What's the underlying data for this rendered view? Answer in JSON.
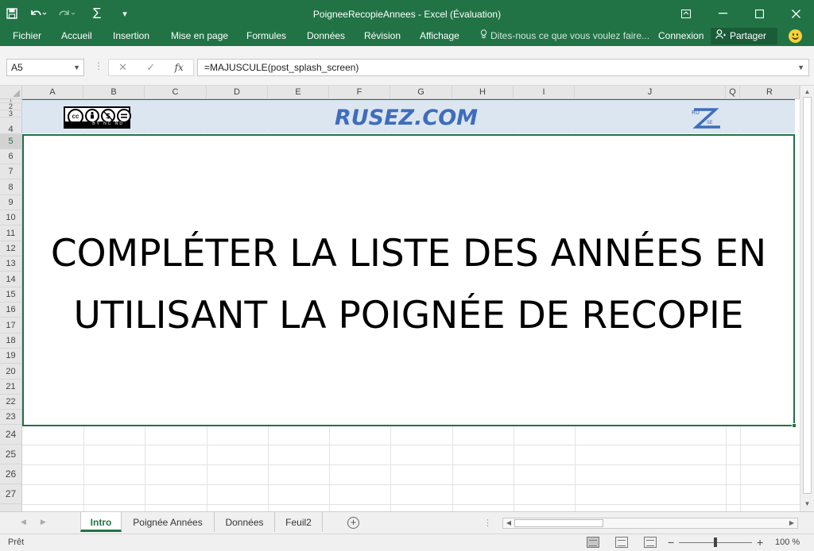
{
  "window": {
    "title": "PoigneeRecopieAnnees - Excel (Évaluation)"
  },
  "qat": {
    "save_icon": "save-icon",
    "undo_icon": "undo-icon",
    "redo_icon": "redo-icon",
    "autosum_glyph": "Σ",
    "customize_glyph": "▾"
  },
  "ribbon": {
    "tabs": [
      "Fichier",
      "Accueil",
      "Insertion",
      "Mise en page",
      "Formules",
      "Données",
      "Révision",
      "Affichage"
    ],
    "tell_me": "Dites-nous ce que vous voulez faire...",
    "sign_in": "Connexion",
    "share": "Partager"
  },
  "formula_bar": {
    "name_box": "A5",
    "cancel_glyph": "✕",
    "enter_glyph": "✓",
    "fx_label": "fx",
    "formula": "=MAJUSCULE(post_splash_screen)"
  },
  "columns": [
    "A",
    "B",
    "C",
    "D",
    "E",
    "F",
    "G",
    "H",
    "I",
    "J",
    "Q",
    "R"
  ],
  "rows": [
    "1",
    "2",
    "3",
    "4",
    "5",
    "6",
    "7",
    "8",
    "9",
    "10",
    "11",
    "12",
    "13",
    "14",
    "15",
    "16",
    "17",
    "18",
    "19",
    "20",
    "21",
    "22",
    "23",
    "24",
    "25",
    "26",
    "27"
  ],
  "banner": {
    "brand": "RUSEZ.COM",
    "license_strip": "BY NC ND",
    "license_cc": "cc",
    "z_logo": {
      "letter": "Z",
      "small_top": "RU",
      "small_bottom": "SE"
    }
  },
  "main": {
    "line1": "COMPLÉTER LA LISTE DES ANNÉES EN",
    "line2": "UTILISANT LA POIGNÉE DE RECOPIE"
  },
  "sheets": {
    "tabs": [
      "Intro",
      "Poignée Années",
      "Données",
      "Feuil2"
    ],
    "active": "Intro",
    "add_glyph": "+"
  },
  "status": {
    "text": "Prêt",
    "zoom": "100 %",
    "zoom_fraction": 0.5
  },
  "colors": {
    "accent": "#217346",
    "brand_text": "#3e6dbb",
    "banner_fill": "#dce6f1"
  }
}
